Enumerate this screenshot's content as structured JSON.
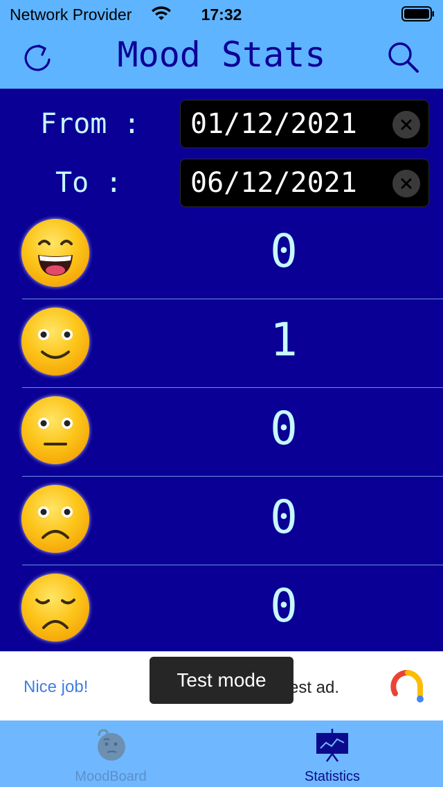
{
  "status_bar": {
    "carrier": "Network Provider",
    "time": "17:32"
  },
  "header": {
    "title": "Mood Stats",
    "refresh_icon": "refresh-icon",
    "search_icon": "search-icon"
  },
  "date_range": {
    "from_label": "From :",
    "from_value": "01/12/2021",
    "to_label": "To :",
    "to_value": "06/12/2021"
  },
  "moods": [
    {
      "name": "grinning-emoji",
      "count": "0"
    },
    {
      "name": "smiling-emoji",
      "count": "1"
    },
    {
      "name": "neutral-emoji",
      "count": "0"
    },
    {
      "name": "frowning-emoji",
      "count": "0"
    },
    {
      "name": "sad-emoji",
      "count": "0"
    }
  ],
  "ad": {
    "left_text": "Nice job!",
    "right_text": "est ad.",
    "toast": "Test mode"
  },
  "tabs": [
    {
      "label": "MoodBoard",
      "active": false
    },
    {
      "label": "Statistics",
      "active": true
    }
  ],
  "colors": {
    "background": "#0a0096",
    "header": "#5fb4ff",
    "text": "#c7f7ff",
    "tab_active": "#0c0a8c"
  }
}
